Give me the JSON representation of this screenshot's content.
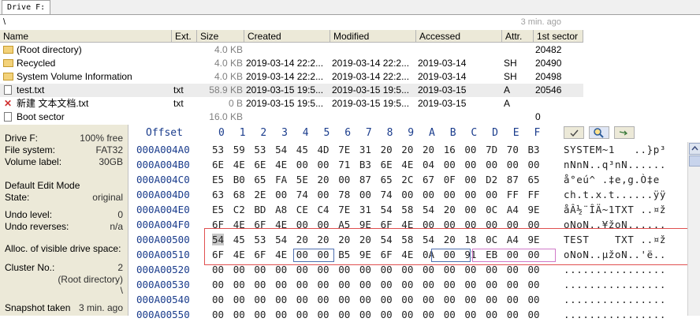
{
  "tab": {
    "label": "Drive F:"
  },
  "path": {
    "text": "\\",
    "age": "3 min. ago"
  },
  "filelist": {
    "columns": [
      "Name",
      "Ext.",
      "Size",
      "Created",
      "Modified",
      "Accessed",
      "Attr.",
      "1st sector"
    ],
    "rows": [
      {
        "icon": "folder-icon",
        "name": "(Root directory)",
        "ext": "",
        "size": "4.0 KB",
        "created": "",
        "modified": "",
        "accessed": "",
        "attr": "",
        "sector": "20482"
      },
      {
        "icon": "folder-icon",
        "name": "Recycled",
        "ext": "",
        "size": "4.0 KB",
        "created": "2019-03-14  22:2...",
        "modified": "2019-03-14  22:2...",
        "accessed": "2019-03-14",
        "attr": "SH",
        "sector": "20490"
      },
      {
        "icon": "folder-icon",
        "name": "System Volume Information",
        "ext": "",
        "size": "4.0 KB",
        "created": "2019-03-14  22:2...",
        "modified": "2019-03-14  22:2...",
        "accessed": "2019-03-14",
        "attr": "SH",
        "sector": "20498"
      },
      {
        "icon": "file-icon",
        "name": "test.txt",
        "ext": "txt",
        "size": "58.9 KB",
        "created": "2019-03-15  19:5...",
        "modified": "2019-03-15  19:5...",
        "accessed": "2019-03-15",
        "attr": "A",
        "sector": "20546"
      },
      {
        "icon": "deleted-file-icon",
        "name": "新建 文本文档.txt",
        "ext": "txt",
        "size": "0 B",
        "created": "2019-03-15  19:5...",
        "modified": "2019-03-15  19:5...",
        "accessed": "2019-03-15",
        "attr": "A",
        "sector": ""
      },
      {
        "icon": "file-icon",
        "name": "Boot sector",
        "ext": "",
        "size": "16.0 KB",
        "created": "",
        "modified": "",
        "accessed": "",
        "attr": "",
        "sector": "0"
      }
    ]
  },
  "info": {
    "drive_label": "Drive F:",
    "drive_free": "100% free",
    "fs_label": "File system:",
    "fs_value": "FAT32",
    "vol_label": "Volume label:",
    "vol_value": "30GB",
    "edit_mode": "Default Edit Mode",
    "state_label": "State:",
    "state_value": "original",
    "undo_level_label": "Undo level:",
    "undo_level_value": "0",
    "undo_rev_label": "Undo reverses:",
    "undo_rev_value": "n/a",
    "alloc_label": "Alloc. of visible drive space:",
    "cluster_label": "Cluster No.:",
    "cluster_value": "2",
    "cluster_dir": "(Root directory)",
    "cluster_path": "\\",
    "snapshot_label": "Snapshot taken",
    "snapshot_value": "3 min. ago"
  },
  "hex": {
    "offset_header": "Offset",
    "col_headers": [
      "0",
      "1",
      "2",
      "3",
      "4",
      "5",
      "6",
      "7",
      "8",
      "9",
      "A",
      "B",
      "C",
      "D",
      "E",
      "F"
    ],
    "rows": [
      {
        "offset": "000A004A0",
        "bytes": [
          "53",
          "59",
          "53",
          "54",
          "45",
          "4D",
          "7E",
          "31",
          "20",
          "20",
          "20",
          "16",
          "00",
          "7D",
          "70",
          "B3"
        ],
        "ascii": "SYSTEM~1   ..}p³"
      },
      {
        "offset": "000A004B0",
        "bytes": [
          "6E",
          "4E",
          "6E",
          "4E",
          "00",
          "00",
          "71",
          "B3",
          "6E",
          "4E",
          "04",
          "00",
          "00",
          "00",
          "00",
          "00"
        ],
        "ascii": "nNnN..q³nN......"
      },
      {
        "offset": "000A004C0",
        "bytes": [
          "E5",
          "B0",
          "65",
          "FA",
          "5E",
          "20",
          "00",
          "87",
          "65",
          "2C",
          "67",
          "0F",
          "00",
          "D2",
          "87",
          "65"
        ],
        "ascii": "å°eú^ .‡e,g.Ò‡e"
      },
      {
        "offset": "000A004D0",
        "bytes": [
          "63",
          "68",
          "2E",
          "00",
          "74",
          "00",
          "78",
          "00",
          "74",
          "00",
          "00",
          "00",
          "00",
          "00",
          "FF",
          "FF"
        ],
        "ascii": "ch.t.x.t......ÿÿ"
      },
      {
        "offset": "000A004E0",
        "bytes": [
          "E5",
          "C2",
          "BD",
          "A8",
          "CE",
          "C4",
          "7E",
          "31",
          "54",
          "58",
          "54",
          "20",
          "00",
          "0C",
          "A4",
          "9E"
        ],
        "ascii": "åÂ½¨ÎÄ~1TXT ..¤ž"
      },
      {
        "offset": "000A004F0",
        "bytes": [
          "6F",
          "4E",
          "6F",
          "4E",
          "00",
          "00",
          "A5",
          "9E",
          "6F",
          "4E",
          "00",
          "00",
          "00",
          "00",
          "00",
          "00"
        ],
        "ascii": "oNoN..¥žoN......"
      },
      {
        "offset": "000A00500",
        "bytes": [
          "54",
          "45",
          "53",
          "54",
          "20",
          "20",
          "20",
          "20",
          "54",
          "58",
          "54",
          "20",
          "18",
          "0C",
          "A4",
          "9E"
        ],
        "ascii": "TEST    TXT ..¤ž"
      },
      {
        "offset": "000A00510",
        "bytes": [
          "6F",
          "4E",
          "6F",
          "4E",
          "00",
          "00",
          "B5",
          "9E",
          "6F",
          "4E",
          "0A",
          "00",
          "91",
          "EB",
          "00",
          "00"
        ],
        "ascii": "oNoN..µžoN..'ë.."
      },
      {
        "offset": "000A00520",
        "bytes": [
          "00",
          "00",
          "00",
          "00",
          "00",
          "00",
          "00",
          "00",
          "00",
          "00",
          "00",
          "00",
          "00",
          "00",
          "00",
          "00"
        ],
        "ascii": "................"
      },
      {
        "offset": "000A00530",
        "bytes": [
          "00",
          "00",
          "00",
          "00",
          "00",
          "00",
          "00",
          "00",
          "00",
          "00",
          "00",
          "00",
          "00",
          "00",
          "00",
          "00"
        ],
        "ascii": "................"
      },
      {
        "offset": "000A00540",
        "bytes": [
          "00",
          "00",
          "00",
          "00",
          "00",
          "00",
          "00",
          "00",
          "00",
          "00",
          "00",
          "00",
          "00",
          "00",
          "00",
          "00"
        ],
        "ascii": "................"
      },
      {
        "offset": "000A00550",
        "bytes": [
          "00",
          "00",
          "00",
          "00",
          "00",
          "00",
          "00",
          "00",
          "00",
          "00",
          "00",
          "00",
          "00",
          "00",
          "00",
          "00"
        ],
        "ascii": "................"
      }
    ]
  },
  "colors": {
    "accent": "#1a3c8c",
    "highlight_box": "#e05050",
    "panel_bg": "#ece9d8"
  }
}
